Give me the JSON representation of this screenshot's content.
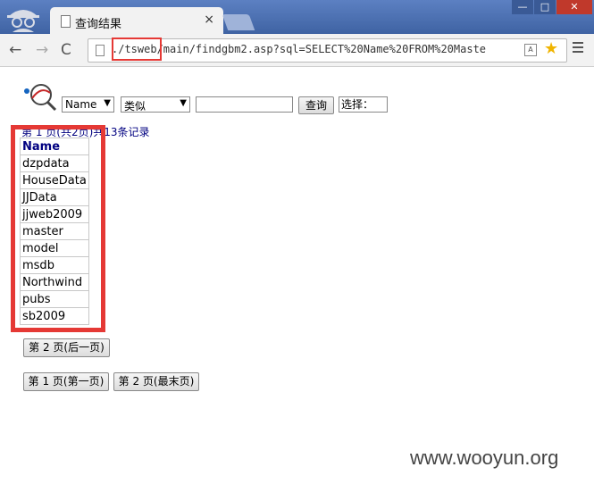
{
  "browser": {
    "tab_title": "查询结果",
    "tab_close": "×",
    "url": "./tsweb/main/findgbm2.asp?sql=SELECT%20Name%20FROM%20Maste",
    "back": "←",
    "forward": "→",
    "reload": "C",
    "star": "★",
    "window_min": "—",
    "window_max": "□",
    "window_close": "✕"
  },
  "search": {
    "field_selected": "Name",
    "operator_selected": "类似",
    "value": "",
    "query_button": "查询",
    "choose_label": "选择："
  },
  "page_info": "第 1 页(共2页)共13条记录",
  "table": {
    "header": "Name",
    "rows": [
      "dzpdata",
      "HouseData",
      "JJData",
      "jjweb2009",
      "master",
      "model",
      "msdb",
      "Northwind",
      "pubs",
      "sb2009"
    ]
  },
  "pagination": {
    "next": "第 2 页(后一页)",
    "first": "第 1 页(第一页)",
    "last": "第 2 页(最末页)"
  },
  "watermark": "www.wooyun.org",
  "colors": {
    "highlight": "#e53935",
    "link_blue": "#000080",
    "titlebar": "#4a6fae"
  }
}
